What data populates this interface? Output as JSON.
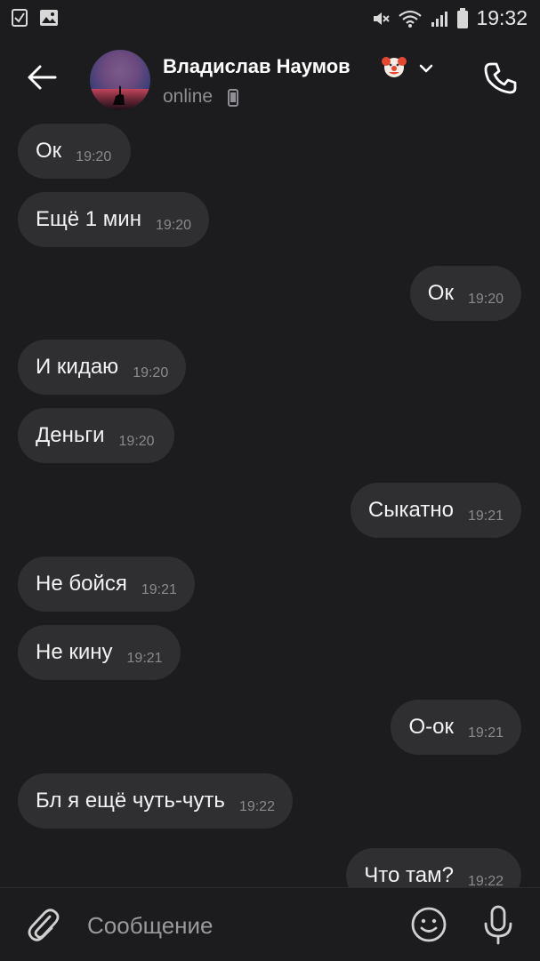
{
  "status_bar": {
    "time": "19:32",
    "icons": [
      "checkbox-notification-icon",
      "gallery-notification-icon",
      "mute-icon",
      "wifi-icon",
      "signal-icon",
      "battery-icon"
    ]
  },
  "header": {
    "contact_name": "Владислав Наумов",
    "name_emoji_icon": "clown-face-icon",
    "status": "online",
    "icons": [
      "back-arrow-icon",
      "chevron-down-icon",
      "phone-device-icon",
      "phone-call-icon"
    ]
  },
  "messages": [
    {
      "side": "in",
      "text": "Ок",
      "time": "19:20"
    },
    {
      "side": "in",
      "text": "Ещё 1 мин",
      "time": "19:20"
    },
    {
      "side": "out",
      "text": "Ок",
      "time": "19:20"
    },
    {
      "side": "in",
      "text": "И кидаю",
      "time": "19:20"
    },
    {
      "side": "in",
      "text": "Деньги",
      "time": "19:20"
    },
    {
      "side": "out",
      "text": "Сыкатно",
      "time": "19:21"
    },
    {
      "side": "in",
      "text": "Не бойся",
      "time": "19:21"
    },
    {
      "side": "in",
      "text": "Не кину",
      "time": "19:21"
    },
    {
      "side": "out",
      "text": "О-ок",
      "time": "19:21"
    },
    {
      "side": "in",
      "text": "Бл я ещё чуть-чуть",
      "time": "19:22"
    },
    {
      "side": "out",
      "text": "Что там?",
      "time": "19:22"
    }
  ],
  "composer": {
    "placeholder": "Сообщение",
    "value": "",
    "icons": [
      "paperclip-icon",
      "emoji-smile-icon",
      "microphone-icon"
    ]
  },
  "colors": {
    "background": "#1c1c1e",
    "bubble": "#2f2f32",
    "text": "#f2f2f2",
    "secondary_text": "#8e8e93",
    "timestamp": "#8a8a8e"
  }
}
